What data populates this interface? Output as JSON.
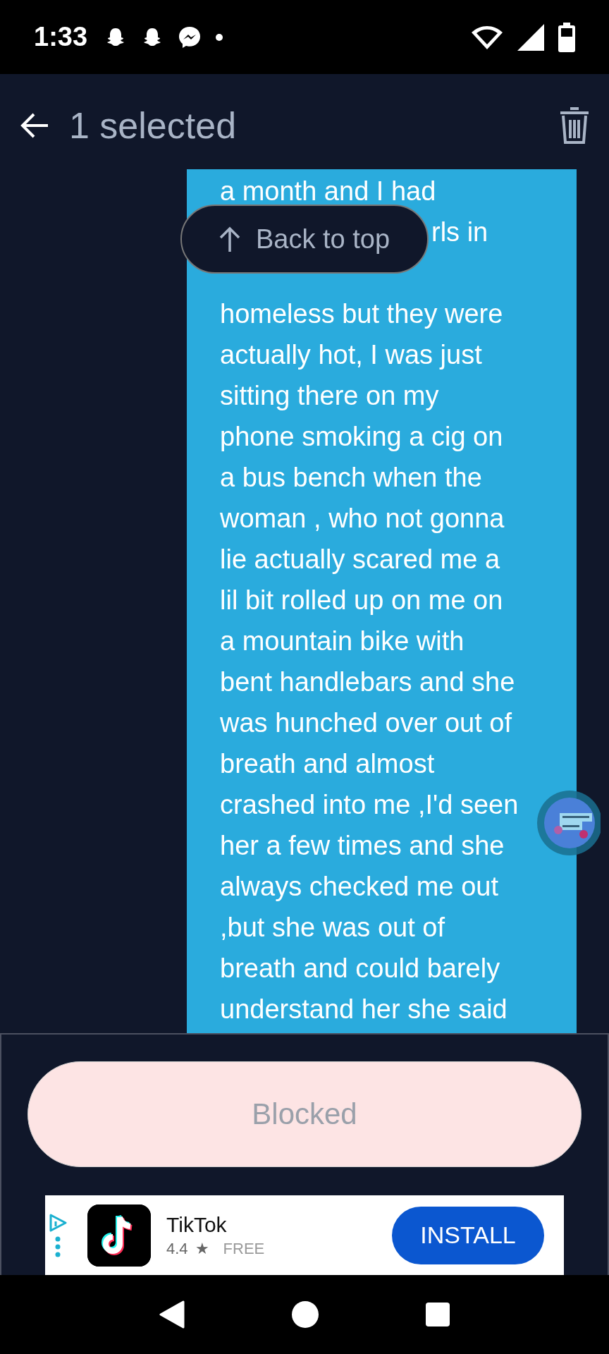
{
  "status_bar": {
    "time": "1:33"
  },
  "app_bar": {
    "title": "1 selected"
  },
  "message": {
    "lines": [
      {
        "text": "a month and I had",
        "kind": "full"
      },
      {
        "text": "rls in",
        "kind": "tail"
      },
      {
        "text": "homeless but they were",
        "kind": "full"
      },
      {
        "text": "actually hot, I was just",
        "kind": "full"
      },
      {
        "text": "sitting there on my",
        "kind": "full"
      },
      {
        "text": "phone smoking a cig on",
        "kind": "full"
      },
      {
        "text": "a bus bench when the",
        "kind": "full"
      },
      {
        "text": "woman , who not gonna",
        "kind": "full"
      },
      {
        "text": "lie actually scared me a",
        "kind": "full"
      },
      {
        "text": "lil bit rolled up on me on",
        "kind": "full"
      },
      {
        "text": "a mountain bike with",
        "kind": "full"
      },
      {
        "text": "bent handlebars and she",
        "kind": "full"
      },
      {
        "text": "was hunched over out of",
        "kind": "full"
      },
      {
        "text": "breath and almost",
        "kind": "full"
      },
      {
        "text": "crashed into me ,I'd seen",
        "kind": "full"
      },
      {
        "text": "her a few times and she",
        "kind": "full"
      },
      {
        "text": "always checked me out",
        "kind": "full"
      },
      {
        "text": ",but she was out of",
        "kind": "full"
      },
      {
        "text": "breath and could barely",
        "kind": "full"
      },
      {
        "text": "understand her she said",
        "kind": "full"
      }
    ]
  },
  "back_to_top": {
    "label": "Back to top"
  },
  "blocked_button": {
    "label": "Blocked",
    "disabled": true
  },
  "ad": {
    "app_name": "TikTok",
    "rating": "4.4",
    "rating_star": "★",
    "price": "FREE",
    "install": "INSTALL"
  }
}
